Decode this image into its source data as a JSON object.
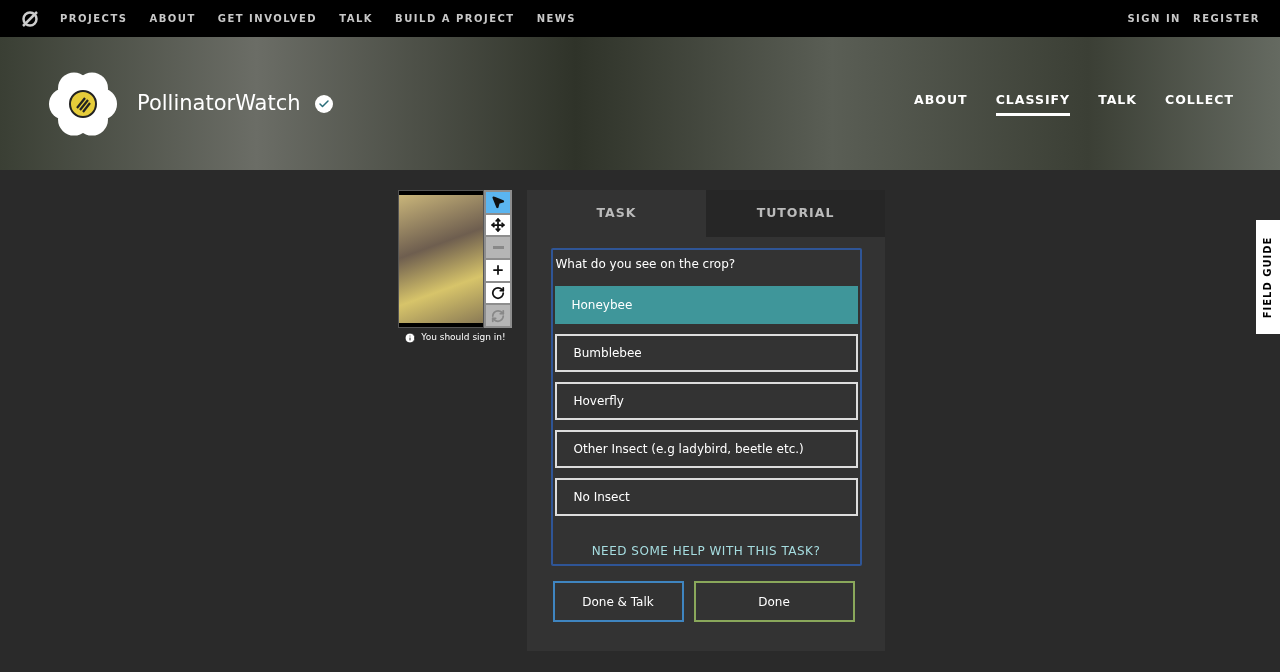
{
  "top_nav": {
    "links": [
      "PROJECTS",
      "ABOUT",
      "GET INVOLVED",
      "TALK",
      "BUILD A PROJECT",
      "NEWS"
    ],
    "account": [
      "SIGN IN",
      "REGISTER"
    ]
  },
  "project": {
    "name": "PollinatorWatch",
    "verified": true,
    "nav": [
      {
        "label": "ABOUT",
        "selected": false
      },
      {
        "label": "CLASSIFY",
        "selected": true
      },
      {
        "label": "TALK",
        "selected": false
      },
      {
        "label": "COLLECT",
        "selected": false
      }
    ]
  },
  "viewer": {
    "tools": [
      {
        "kind": "pointer",
        "selected": true,
        "disabled": false
      },
      {
        "kind": "move",
        "selected": false,
        "disabled": false
      },
      {
        "kind": "zoom-out",
        "selected": false,
        "disabled": true
      },
      {
        "kind": "zoom-in",
        "selected": false,
        "disabled": false
      },
      {
        "kind": "rotate",
        "selected": false,
        "disabled": false
      },
      {
        "kind": "reset",
        "selected": false,
        "disabled": true
      }
    ],
    "notice": "You should sign in!"
  },
  "tabs": [
    {
      "label": "TASK",
      "selected": true
    },
    {
      "label": "TUTORIAL",
      "selected": false
    }
  ],
  "task": {
    "question": "What do you see on the crop?",
    "answers": [
      {
        "label": "Honeybee",
        "selected": true
      },
      {
        "label": "Bumblebee",
        "selected": false
      },
      {
        "label": "Hoverfly",
        "selected": false
      },
      {
        "label": "Other Insect (e.g ladybird, beetle etc.)",
        "selected": false
      },
      {
        "label": "No Insect",
        "selected": false
      }
    ],
    "help": "NEED SOME HELP WITH THIS TASK?"
  },
  "buttons": [
    {
      "kind": "talk",
      "label": "Done & Talk"
    },
    {
      "kind": "done",
      "label": "Done"
    }
  ],
  "field_guide": "FIELD GUIDE"
}
